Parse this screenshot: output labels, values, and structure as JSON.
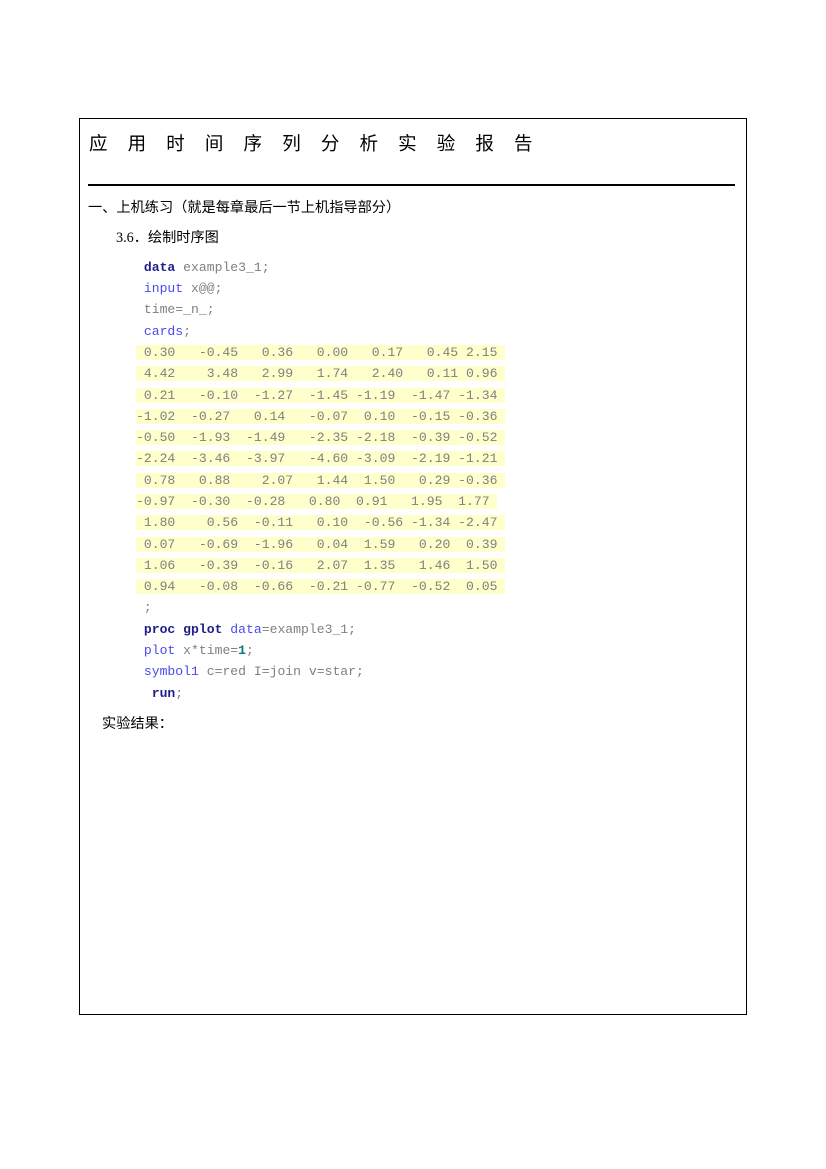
{
  "document": {
    "title": "应 用 时 间 序 列 分 析 实 验 报 告",
    "section_heading": "一、上机练习（就是每章最后一节上机指导部分）",
    "subsection_heading": "3.6．绘制时序图",
    "result_label": "实验结果："
  },
  "code": {
    "language": "SAS",
    "lines": [
      {
        "id": "line-data-stmt",
        "tokens": [
          {
            "t": " ",
            "c": "plain"
          },
          {
            "t": "data",
            "c": "keyword"
          },
          {
            "t": " example3_1;",
            "c": "plain"
          }
        ]
      },
      {
        "id": "line-input",
        "tokens": [
          {
            "t": " ",
            "c": "plain"
          },
          {
            "t": "input",
            "c": "proc"
          },
          {
            "t": " x@@;",
            "c": "plain"
          }
        ]
      },
      {
        "id": "line-time",
        "tokens": [
          {
            "t": " time=_n_;",
            "c": "plain"
          }
        ]
      },
      {
        "id": "line-cards",
        "tokens": [
          {
            "t": " ",
            "c": "plain"
          },
          {
            "t": "cards",
            "c": "proc"
          },
          {
            "t": ";",
            "c": "plain"
          }
        ]
      }
    ],
    "data_rows": [
      " 0.30   -0.45   0.36   0.00   0.17   0.45 2.15 ",
      " 4.42    3.48   2.99   1.74   2.40   0.11 0.96 ",
      " 0.21   -0.10  -1.27  -1.45 -1.19  -1.47 -1.34 ",
      "-1.02  -0.27   0.14   -0.07  0.10  -0.15 -0.36 ",
      "-0.50  -1.93  -1.49   -2.35 -2.18  -0.39 -0.52 ",
      "-2.24  -3.46  -3.97   -4.60 -3.09  -2.19 -1.21 ",
      " 0.78   0.88    2.07   1.44  1.50   0.29 -0.36 ",
      "-0.97  -0.30  -0.28   0.80  0.91   1.95  1.77 ",
      " 1.80    0.56  -0.11   0.10  -0.56 -1.34 -2.47 ",
      " 0.07   -0.69  -1.96   0.04  1.59   0.20  0.39 ",
      " 1.06   -0.39  -0.16   2.07  1.35   1.46  1.50 ",
      " 0.94   -0.08  -0.66  -0.21 -0.77  -0.52  0.05 "
    ],
    "trailing_lines": [
      {
        "id": "line-semicolon",
        "tokens": [
          {
            "t": " ;",
            "c": "plain"
          }
        ]
      },
      {
        "id": "line-proc-gplot",
        "tokens": [
          {
            "t": " ",
            "c": "plain"
          },
          {
            "t": "proc gplot",
            "c": "keyword"
          },
          {
            "t": " ",
            "c": "plain"
          },
          {
            "t": "data",
            "c": "proc"
          },
          {
            "t": "=example3_1;",
            "c": "plain"
          }
        ]
      },
      {
        "id": "line-plot",
        "tokens": [
          {
            "t": " ",
            "c": "plain"
          },
          {
            "t": "plot",
            "c": "proc"
          },
          {
            "t": " x*time=",
            "c": "plain"
          },
          {
            "t": "1",
            "c": "number"
          },
          {
            "t": ";",
            "c": "plain"
          }
        ]
      },
      {
        "id": "line-symbol1",
        "tokens": [
          {
            "t": " ",
            "c": "plain"
          },
          {
            "t": "symbol1",
            "c": "proc"
          },
          {
            "t": " c=red I=join v=star;",
            "c": "plain"
          }
        ]
      },
      {
        "id": "line-run",
        "tokens": [
          {
            "t": "  ",
            "c": "plain"
          },
          {
            "t": "run",
            "c": "keyword"
          },
          {
            "t": ";",
            "c": "plain"
          }
        ]
      }
    ]
  },
  "colors": {
    "keyword": "#1f1f8c",
    "procedure": "#4a4af0",
    "plain_code": "#808080",
    "number": "#0b7a7a",
    "highlight_background": "#ffffcc",
    "page_border": "#000000",
    "text": "#000000"
  }
}
